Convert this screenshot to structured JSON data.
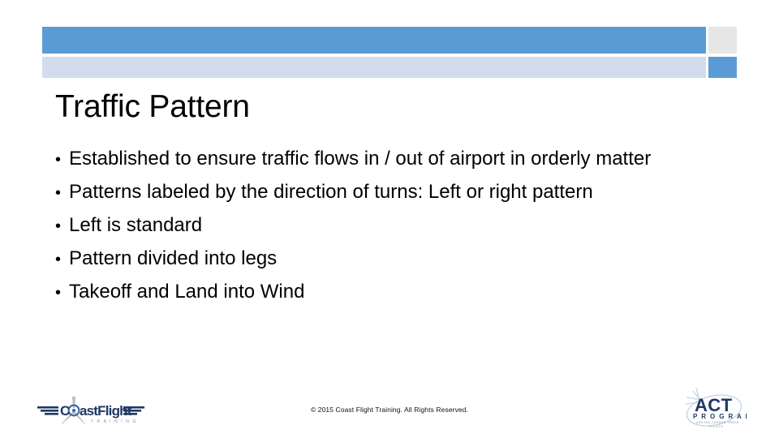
{
  "slide": {
    "title": "Traffic Pattern",
    "bullet_char": "•",
    "bullets": [
      {
        "text": "Established to ensure traffic flows in / out of airport in orderly matter"
      },
      {
        "text": "Patterns labeled by the direction of turns: Left or right pattern"
      },
      {
        "text": "Left is standard"
      },
      {
        "text": "Pattern divided into legs"
      },
      {
        "text": "Takeoff and Land into Wind"
      }
    ]
  },
  "header": {
    "bar_primary_color": "#5b9bd5",
    "bar_secondary_color": "#d2dcee",
    "accent_gray_color": "#e6e6e6"
  },
  "footer": {
    "copyright": "© 2015 Coast Flight Training. All Rights Reserved."
  },
  "logos": {
    "left": {
      "name": "coastflight-training-logo",
      "wordmark_primary": "C",
      "wordmark_rest": "astFlight",
      "wordmark_sub": "T R A I N I N G",
      "wing_color": "#1f3864",
      "prop_color": "#a6a6a6",
      "ring_color": "#3f6aa8"
    },
    "right": {
      "name": "act-program-logo",
      "wordmark": "ACT",
      "wordmark_sub": "P R O G R A M",
      "tagline_line1": "AIRLINE CAREER TRACK",
      "tagline_line2": "PILOTS",
      "mark_color": "#1f3864",
      "swoosh_color": "#b8c7de"
    }
  }
}
